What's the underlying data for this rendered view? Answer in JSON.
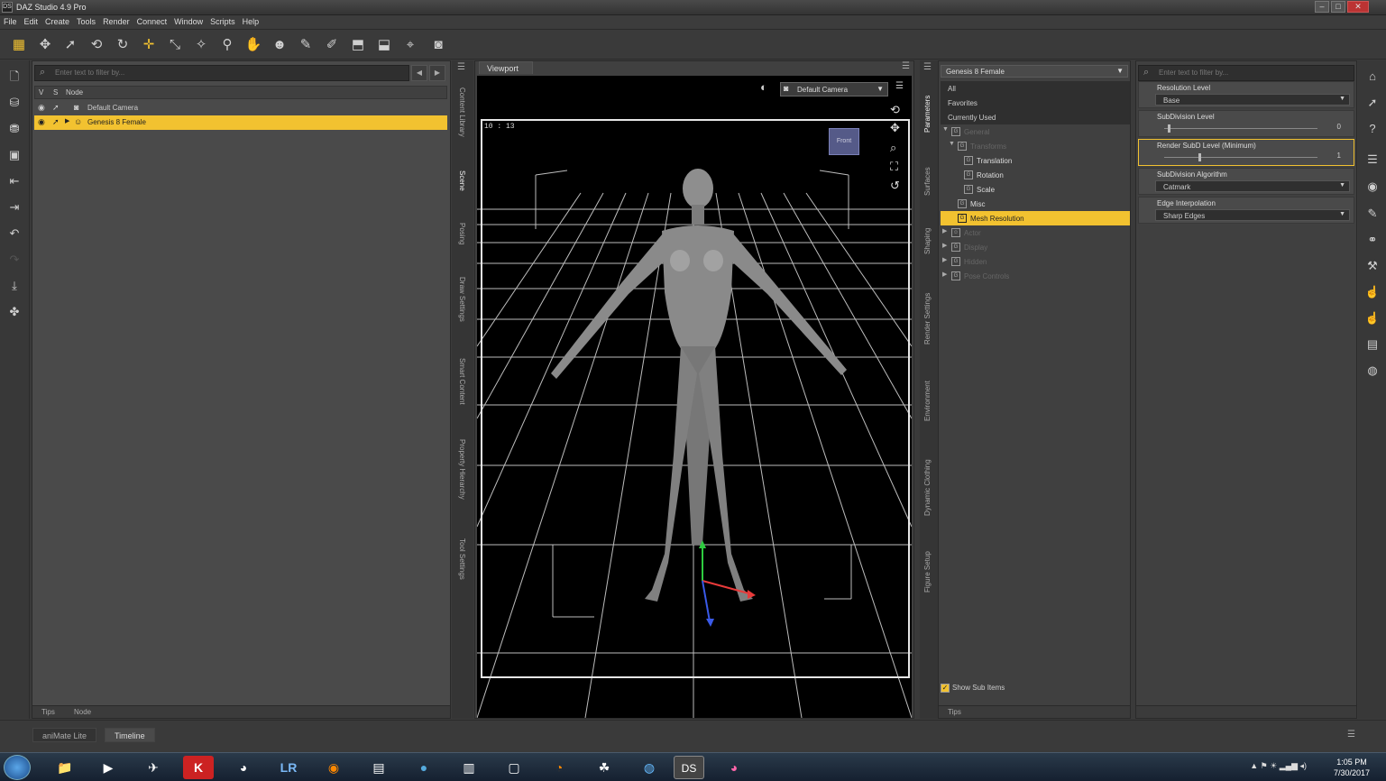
{
  "window": {
    "title": "DAZ Studio 4.9 Pro",
    "app_icon": "DS"
  },
  "menu": [
    "File",
    "Edit",
    "Create",
    "Tools",
    "Render",
    "Connect",
    "Window",
    "Scripts",
    "Help"
  ],
  "scene": {
    "filter_placeholder": "Enter text to filter by...",
    "header": {
      "v": "V",
      "s": "S",
      "node": "Node"
    },
    "rows": [
      {
        "label": "Default Camera"
      },
      {
        "label": "Genesis 8 Female"
      }
    ],
    "bottom_tabs": [
      "Tips",
      "Node"
    ]
  },
  "left_vtabs": [
    "Content Library",
    "Scene",
    "Posing",
    "Draw Settings",
    "Smart Content",
    "Property Hierarchy",
    "Tool Settings"
  ],
  "viewport": {
    "tab": "Viewport",
    "camera": "Default Camera",
    "resolution": "10 : 13",
    "cube_label": "Front"
  },
  "right_vtabs": [
    "Parameters",
    "Surfaces",
    "Shaping",
    "Render Settings",
    "Environment",
    "Dynamic Clothing",
    "Figure Setup"
  ],
  "params": {
    "node": "Genesis 8 Female",
    "nav": [
      "All",
      "Favorites",
      "Currently Used"
    ],
    "tree": [
      {
        "label": "General"
      },
      {
        "label": "Transforms"
      },
      {
        "label": "Translation"
      },
      {
        "label": "Rotation"
      },
      {
        "label": "Scale"
      },
      {
        "label": "Misc"
      },
      {
        "label": "Mesh Resolution"
      },
      {
        "label": "Actor"
      },
      {
        "label": "Display"
      },
      {
        "label": "Hidden"
      },
      {
        "label": "Pose Controls"
      }
    ],
    "show_sub_items": "Show Sub Items",
    "bottom_tab": "Tips"
  },
  "props": {
    "filter_placeholder": "Enter text to filter by...",
    "items": [
      {
        "label": "Resolution Level",
        "value": "Base"
      },
      {
        "label": "SubDivision Level",
        "value": "0"
      },
      {
        "label": "Render SubD Level (Minimum)",
        "value": "1"
      },
      {
        "label": "SubDivision Algorithm",
        "value": "Catmark"
      },
      {
        "label": "Edge Interpolation",
        "value": "Sharp Edges"
      }
    ]
  },
  "bottom_tabs": [
    "aniMate Lite",
    "Timeline"
  ],
  "taskbar": {
    "time": "1:05 PM",
    "date": "7/30/2017",
    "lr": "LR",
    "k": "K",
    "ds": "DS"
  },
  "colors": {
    "selection": "#f2c230",
    "panel": "#4a4a4a",
    "viewport_bg": "#000000"
  }
}
